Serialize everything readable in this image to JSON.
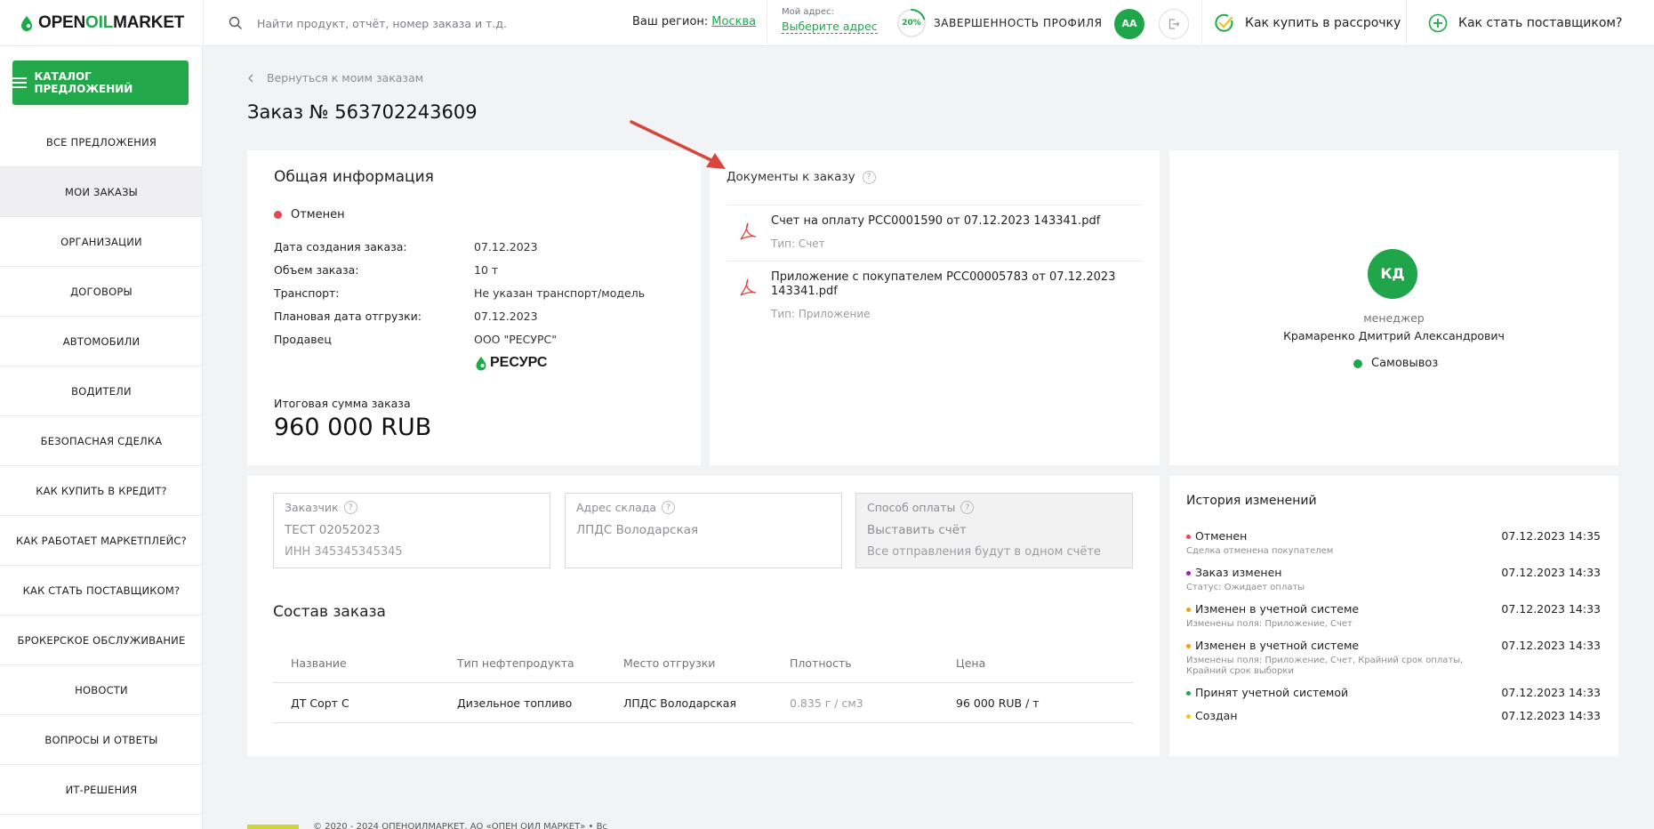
{
  "header": {
    "logo_prefix": "OPEN",
    "logo_accent": "OIL",
    "logo_suffix": "MARKET",
    "search_placeholder": "Найти продукт, отчёт, номер заказа и т.д.",
    "region_label": "Ваш регион:",
    "region_value": "Москва",
    "address_caption": "Мой адрес:",
    "address_link": "Выберите адрес",
    "profile_progress": "20%",
    "profile_progress_value": 0.2,
    "profile_label": "ЗАВЕРШЕННОСТЬ ПРОФИЛЯ",
    "avatar_initials": "АА",
    "installment_link": "Как купить в рассрочку",
    "supplier_link": "Как стать поставщиком?"
  },
  "sidebar": {
    "catalog_button": "КАТАЛОГ ПРЕДЛОЖЕНИЙ",
    "items": [
      {
        "label": "ВСЕ ПРЕДЛОЖЕНИЯ"
      },
      {
        "label": "МОИ ЗАКАЗЫ"
      },
      {
        "label": "ОРГАНИЗАЦИИ"
      },
      {
        "label": "ДОГОВОРЫ"
      },
      {
        "label": "АВТОМОБИЛИ"
      },
      {
        "label": "ВОДИТЕЛИ"
      },
      {
        "label": "БЕЗОПАСНАЯ СДЕЛКА"
      },
      {
        "label": "КАК КУПИТЬ В КРЕДИТ?"
      },
      {
        "label": "КАК РАБОТАЕТ МАРКЕТПЛЕЙС?"
      },
      {
        "label": "КАК СТАТЬ ПОСТАВЩИКОМ?"
      },
      {
        "label": "БРОКЕРСКОЕ ОБСЛУЖИВАНИЕ"
      },
      {
        "label": "НОВОСТИ"
      },
      {
        "label": "ВОПРОСЫ И ОТВЕТЫ"
      },
      {
        "label": "ИТ-РЕШЕНИЯ"
      }
    ]
  },
  "main": {
    "back_link": "Вернуться к моим заказам",
    "title": "Заказ № 563702243609",
    "general": {
      "heading": "Общая информация",
      "status": "Отменен",
      "rows": [
        {
          "k": "Дата создания заказа:",
          "v": "07.12.2023"
        },
        {
          "k": "Объем заказа:",
          "v": "10 т"
        },
        {
          "k": "Транспорт:",
          "v": "Не указан транспорт/модель"
        },
        {
          "k": "Плановая дата отгрузки:",
          "v": "07.12.2023"
        },
        {
          "k": "Продавец",
          "v": "ООО \"РЕСУРС\""
        }
      ],
      "seller_logo": "РЕСУРС",
      "total_caption": "Итоговая сумма заказа",
      "total": "960 000 RUB"
    },
    "documents": {
      "heading": "Документы к заказу",
      "help": "?",
      "items": [
        {
          "name": "Счет на оплату РСС0001590 от 07.12.2023 143341.pdf",
          "type": "Тип: Счет"
        },
        {
          "name": "Приложение с покупателем РСС00005783 от 07.12.2023 143341.pdf",
          "type": "Тип: Приложение"
        }
      ]
    },
    "manager": {
      "initials": "КД",
      "role": "менеджер",
      "name": "Крамаренко Дмитрий Александрович",
      "delivery": "Самовывоз"
    },
    "fields": {
      "customer": {
        "caption": "Заказчик",
        "value": "ТЕСТ 02052023",
        "sub": "ИНН 345345345345"
      },
      "warehouse": {
        "caption": "Адрес склада",
        "value": "ЛПДС Володарская"
      },
      "payment": {
        "caption": "Способ оплаты",
        "value": "Выставить счёт",
        "sub": "Все отправления будут в одном счёте"
      }
    },
    "composition": {
      "heading": "Состав заказа",
      "headers": [
        "Название",
        "Тип нефтепродукта",
        "Место отгрузки",
        "Плотность",
        "Цена"
      ],
      "rows": [
        [
          "ДТ Сорт С",
          "Дизельное топливо",
          "ЛПДС Володарская",
          "0.835 г / см3",
          "96 000 RUB / т"
        ]
      ]
    },
    "history": {
      "heading": "История изменений",
      "items": [
        {
          "title": "Отменен",
          "date": "07.12.2023 14:35",
          "sub": "Сделка отменена покупателем",
          "color": "#e5484d"
        },
        {
          "title": "Заказ изменен",
          "date": "07.12.2023 14:33",
          "sub": "Статус: Ожидает оплаты",
          "color": "#9b1fb6"
        },
        {
          "title": "Изменен в учетной системе",
          "date": "07.12.2023 14:33",
          "sub": "Изменены поля: Приложение, Счет",
          "color": "#f39c12"
        },
        {
          "title": "Изменен в учетной системе",
          "date": "07.12.2023 14:33",
          "sub": "Изменены поля: Приложение, Счет, Крайний срок оплаты, Крайний срок выборки",
          "color": "#f39c12"
        },
        {
          "title": "Принят учетной системой",
          "date": "07.12.2023 14:33",
          "sub": "",
          "color": "#1fa64a"
        },
        {
          "title": "Создан",
          "date": "07.12.2023 14:33",
          "sub": "",
          "color": "#f5c518"
        }
      ]
    }
  },
  "footer": {
    "text": "© 2020 - 2024 ОПЕНОЙЛМАРКЕТ, АО «ОПЕН ОЙЛ МАРКЕТ» • Вс"
  },
  "colors": {
    "brand_green": "#22a84a",
    "status_red": "#e5484d",
    "arrow_red": "#d9443b"
  }
}
